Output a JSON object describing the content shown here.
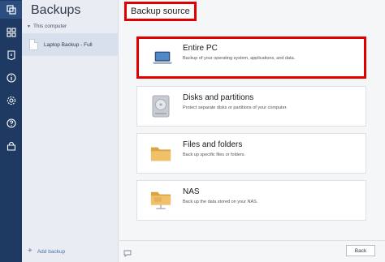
{
  "sidebar": {
    "icons": [
      "backup-icon",
      "dashboard-icon",
      "protection-icon",
      "info-icon",
      "settings-icon",
      "help-icon",
      "shop-icon"
    ]
  },
  "backups_panel": {
    "title": "Backups",
    "group_label": "This computer",
    "items": [
      {
        "label": "Laptop Backup - Full"
      }
    ],
    "add_backup_label": "Add backup"
  },
  "main": {
    "title": "Backup source",
    "options": [
      {
        "title": "Entire PC",
        "description": "Backup of your operating system, applications, and data.",
        "icon": "laptop-icon"
      },
      {
        "title": "Disks and partitions",
        "description": "Protect separate disks or partitions of your computer.",
        "icon": "disk-icon"
      },
      {
        "title": "Files and folders",
        "description": "Back up specific files or folders.",
        "icon": "folder-icon"
      },
      {
        "title": "NAS",
        "description": "Back up the data stored on your NAS.",
        "icon": "nas-icon"
      }
    ],
    "back_label": "Back"
  },
  "colors": {
    "rail": "#1f3a62",
    "highlight": "#e00000",
    "accent": "#4a6fa5"
  }
}
